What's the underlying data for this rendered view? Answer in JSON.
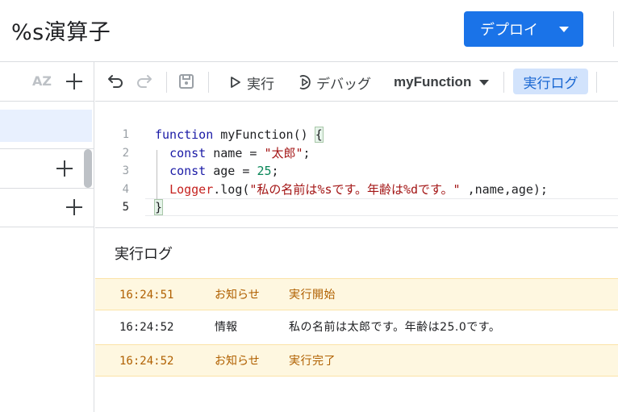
{
  "header": {
    "project_title": "%s演算子",
    "deploy_label": "デプロイ",
    "sort_icon_text": "AZ"
  },
  "toolbar": {
    "run_label": "実行",
    "debug_label": "デバッグ",
    "function_name": "myFunction",
    "log_label": "実行ログ"
  },
  "editor": {
    "line_numbers": [
      "1",
      "2",
      "3",
      "4",
      "5"
    ],
    "active_line": 5,
    "lines": [
      [
        {
          "t": "function",
          "c": "kw"
        },
        {
          "t": " myFunction() "
        },
        {
          "t": "{",
          "c": "hl"
        }
      ],
      [
        {
          "t": "  "
        },
        {
          "t": "const",
          "c": "kw"
        },
        {
          "t": " name = "
        },
        {
          "t": "\"太郎\"",
          "c": "str"
        },
        {
          "t": ";"
        }
      ],
      [
        {
          "t": "  "
        },
        {
          "t": "const",
          "c": "kw"
        },
        {
          "t": " age = "
        },
        {
          "t": "25",
          "c": "num"
        },
        {
          "t": ";"
        }
      ],
      [
        {
          "t": "  "
        },
        {
          "t": "Logger",
          "c": "obj"
        },
        {
          "t": ".log("
        },
        {
          "t": "\"私の名前は%sです。年齢は%dです。\"",
          "c": "str"
        },
        {
          "t": " ,name,age);"
        }
      ],
      [
        {
          "t": "}",
          "c": "hl"
        }
      ]
    ]
  },
  "log": {
    "title": "実行ログ",
    "entries": [
      {
        "time": "16:24:51",
        "type": "お知らせ",
        "message": "実行開始",
        "level": "notice"
      },
      {
        "time": "16:24:52",
        "type": "情報",
        "message": "私の名前は太郎です。年齢は25.0です。",
        "level": "info"
      },
      {
        "time": "16:24:52",
        "type": "お知らせ",
        "message": "実行完了",
        "level": "notice"
      }
    ]
  },
  "colors": {
    "accent": "#1a73e8",
    "notice_bg": "#fef7e0",
    "notice_text": "#b06000",
    "selected_bg": "#e8f0fe"
  },
  "icons": [
    "sort-az-icon",
    "add-icon",
    "undo-icon",
    "redo-icon",
    "save-icon",
    "run-icon",
    "debug-icon",
    "chevron-down-icon"
  ]
}
